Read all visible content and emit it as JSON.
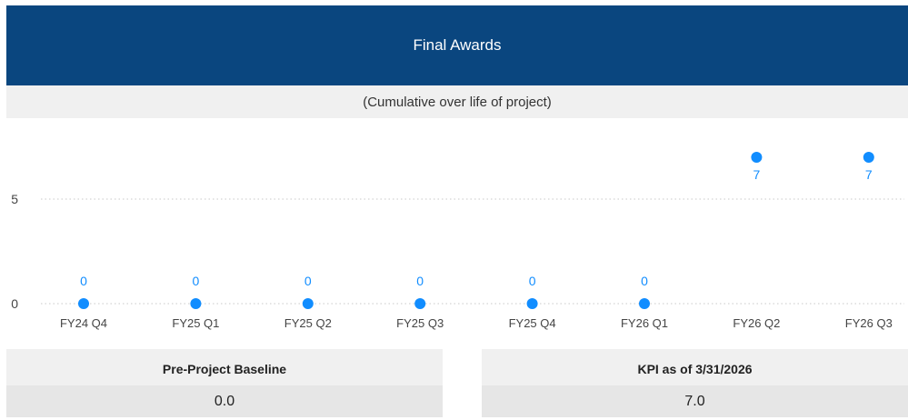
{
  "header": {
    "title": "Final Awards",
    "subtitle": "(Cumulative over life of project)"
  },
  "colors": {
    "header_bg": "#0a467f",
    "point": "#118dff",
    "label": "#118dff"
  },
  "chart_data": {
    "type": "scatter",
    "categories": [
      "FY24 Q4",
      "FY25 Q1",
      "FY25 Q2",
      "FY25 Q3",
      "FY25 Q4",
      "FY26 Q1",
      "FY26 Q2",
      "FY26 Q3"
    ],
    "values": [
      0,
      0,
      0,
      0,
      0,
      0,
      7,
      7
    ],
    "yticks": [
      0,
      5
    ],
    "ylim": [
      0,
      8
    ],
    "grid": true,
    "data_labels": [
      "0",
      "0",
      "0",
      "0",
      "0",
      "0",
      "7",
      "7"
    ]
  },
  "cards": [
    {
      "label": "Pre-Project Baseline",
      "value": "0.0"
    },
    {
      "label": "KPI as of 3/31/2026",
      "value": "7.0"
    }
  ]
}
